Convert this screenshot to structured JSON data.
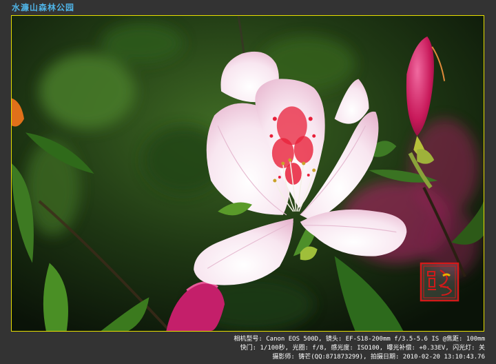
{
  "caption": {
    "title": "水濂山森林公园"
  },
  "photo": {
    "subject": "pink-white azalea flower",
    "accent_colors": {
      "petal": "#f7e4ef",
      "petal_shadow": "#e7bfd6",
      "speckle": "#e8203a",
      "bud": "#d82a6a",
      "leaf": "#2f6e1e",
      "background": "#0f1a0c",
      "frame": "#e8e000"
    }
  },
  "watermark": {
    "seal_text": "摄影作品",
    "seal_color": "#d11a1a"
  },
  "exif": {
    "line1": "相机型号: Canon EOS 500D, 镜头: EF-S18-200mm f/3.5-5.6 IS @焦距: 100mm",
    "line2": "快门: 1/100秒, 光圈: f/8, 感光度: ISO100, 曝光补偿: +0.33EV, 闪光灯: 关",
    "line3": "摄影师: 铸芒(QQ:871873299), 拍摄日期: 2010-02-20 13:10:43.76"
  }
}
